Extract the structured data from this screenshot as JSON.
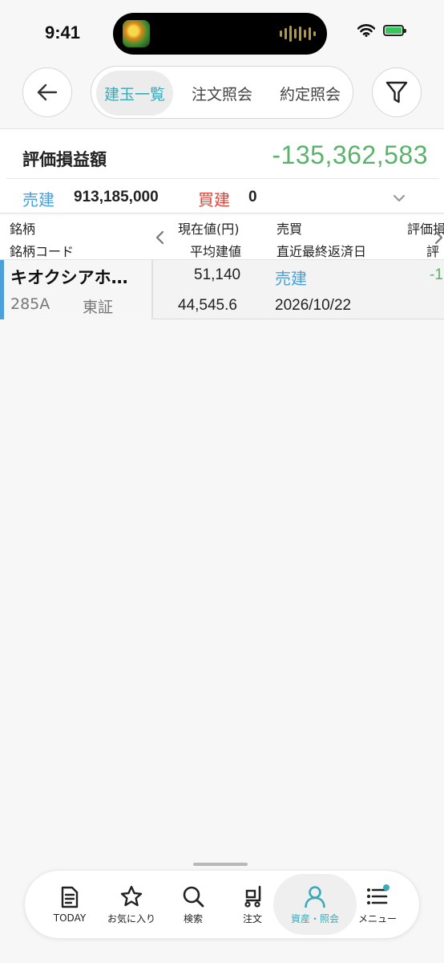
{
  "status_bar": {
    "time": "9:41"
  },
  "header": {
    "tabs": [
      {
        "label": "建玉一覧",
        "active": true
      },
      {
        "label": "注文照会",
        "active": false
      },
      {
        "label": "約定照会",
        "active": false
      }
    ]
  },
  "summary": {
    "pl_label": "評価損益額",
    "pl_value": "-135,362,583",
    "sell_label": "売建",
    "sell_value": "913,185,000",
    "buy_label": "買建",
    "buy_value": "0"
  },
  "table": {
    "headers": {
      "col1_top": "銘柄",
      "col1_bottom": "銘柄コード",
      "col2_top": "現在値(円)",
      "col2_bottom": "平均建値",
      "col3_top": "売買",
      "col3_bottom": "直近最終返済日",
      "col4_top": "評価損",
      "col4_bottom": "評"
    },
    "rows": [
      {
        "name": "キオクシアホ…",
        "code": "285A",
        "market": "東証",
        "current_price": "51,140",
        "avg_price": "44,545.6",
        "side": "売建",
        "last_settlement_date": "2026/10/22",
        "pl_partial": "-1"
      }
    ]
  },
  "tabbar": {
    "items": [
      {
        "label": "TODAY",
        "icon": "document-icon"
      },
      {
        "label": "お気に入り",
        "icon": "star-icon"
      },
      {
        "label": "検索",
        "icon": "search-icon"
      },
      {
        "label": "注文",
        "icon": "cart-icon"
      },
      {
        "label": "資産・照会",
        "icon": "person-icon",
        "active": true
      },
      {
        "label": "メニュー",
        "icon": "list-icon",
        "badge": true
      }
    ]
  },
  "colors": {
    "accent": "#3aa9b8",
    "profit_negative": "#59b36b",
    "sell": "#4aa0d8",
    "buy": "#d9473c"
  }
}
